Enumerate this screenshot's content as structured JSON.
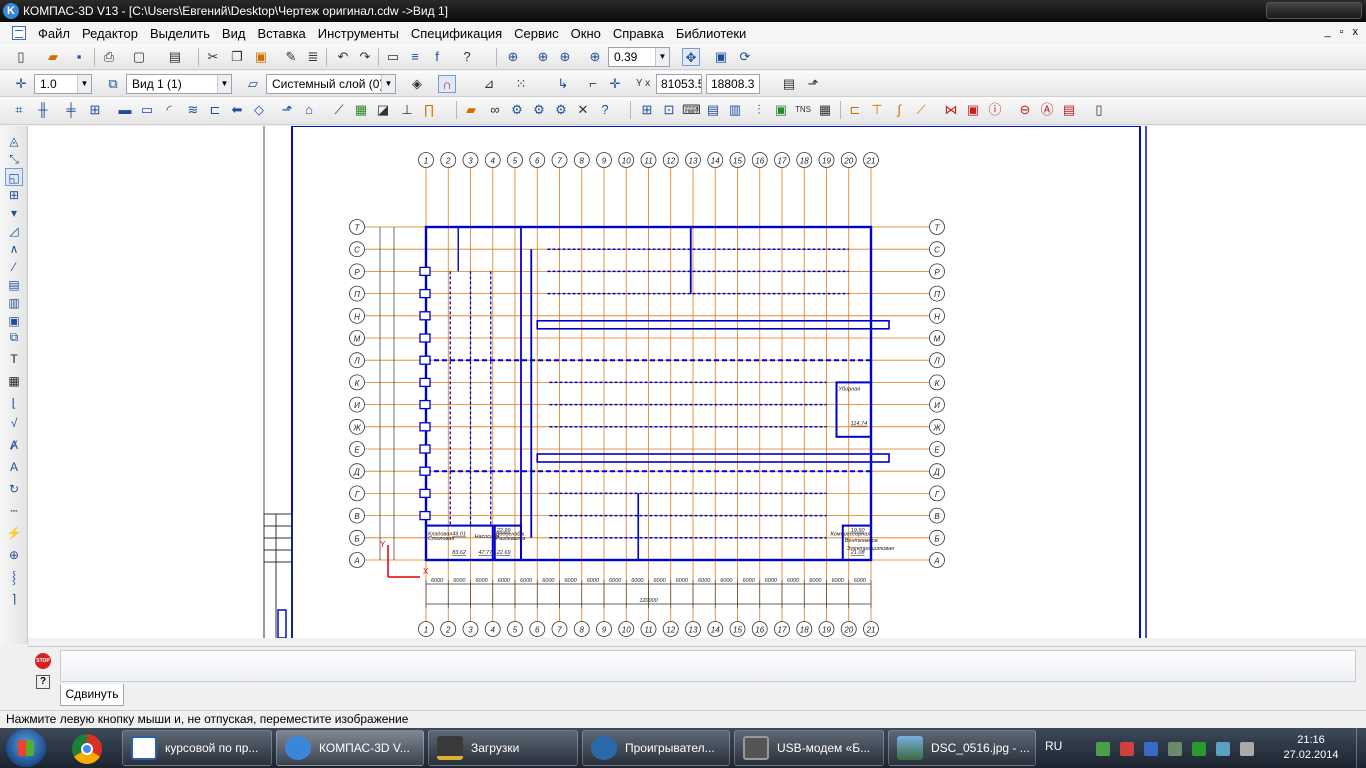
{
  "window": {
    "title": "КОМПАС-3D V13 - [C:\\Users\\Евгений\\Desktop\\Чертеж оригинал.cdw ->Вид 1]"
  },
  "menu": [
    "Файл",
    "Редактор",
    "Выделить",
    "Вид",
    "Вставка",
    "Инструменты",
    "Спецификация",
    "Сервис",
    "Окно",
    "Справка",
    "Библиотеки"
  ],
  "mdi_buttons": [
    "_",
    "▫",
    "x"
  ],
  "toolbar": {
    "zoom_value": "0.39",
    "scale_value": "1.0",
    "view_value": "Вид 1 (1)",
    "layer_value": "Системный слой (0)",
    "coord_x": "81053.5",
    "coord_y": "18808.3",
    "coord_label": "Y x"
  },
  "drawing": {
    "axis_top_labels": [
      "1",
      "2",
      "3",
      "4",
      "5",
      "6",
      "7",
      "8",
      "9",
      "10",
      "11",
      "12",
      "13",
      "14",
      "15",
      "16",
      "17",
      "18",
      "19",
      "20",
      "21"
    ],
    "axis_side_labels": [
      "Т",
      "С",
      "Р",
      "П",
      "Н",
      "М",
      "Л",
      "К",
      "И",
      "Ж",
      "Е",
      "Д",
      "Г",
      "В",
      "Б",
      "А"
    ],
    "dim_spans": [
      "6000",
      "6000",
      "6000",
      "6000",
      "6000",
      "6000",
      "6000",
      "6000",
      "6000",
      "6000",
      "6000",
      "6000",
      "6000",
      "6000",
      "6000",
      "6000",
      "6000",
      "6000",
      "6000",
      "6000"
    ],
    "total_dim": "120000",
    "room_labels": [
      "Кладовая",
      "Столовая",
      "Водоснабж.",
      "Насосная",
      "Раздевалка",
      "Уборная",
      "Компрессорная",
      "Венткамера",
      "Электрощитовая"
    ],
    "room_values": [
      "49.01",
      "83.62",
      "22.99",
      "47.77",
      "22.69",
      "114.74",
      "19.50",
      "21.08"
    ],
    "ucs_x": "X",
    "ucs_y": "Y"
  },
  "command": {
    "tab_label": "Сдвинуть",
    "stop_label": "STOP",
    "help_label": "?"
  },
  "status": {
    "hint": "Нажмите левую кнопку мыши и, не отпуская, переместите изображение"
  },
  "taskbar": {
    "tasks": [
      {
        "label": "курсовой по пр...",
        "active": false
      },
      {
        "label": "КОМПАС-3D V...",
        "active": true
      },
      {
        "label": "Загрузки",
        "active": false
      },
      {
        "label": "Проигрывател...",
        "active": false
      },
      {
        "label": "USB-модем «Б...",
        "active": false
      },
      {
        "label": "DSC_0516.jpg - ...",
        "active": false
      }
    ],
    "language": "RU",
    "time": "21:16",
    "date": "27.02.2014"
  },
  "colors": {
    "drawing_blue": "#0000cc",
    "axis_orange": "#e07a18",
    "frame_blue": "#0010c8",
    "title_bar": "#111111",
    "taskbar": "#1c2430"
  }
}
